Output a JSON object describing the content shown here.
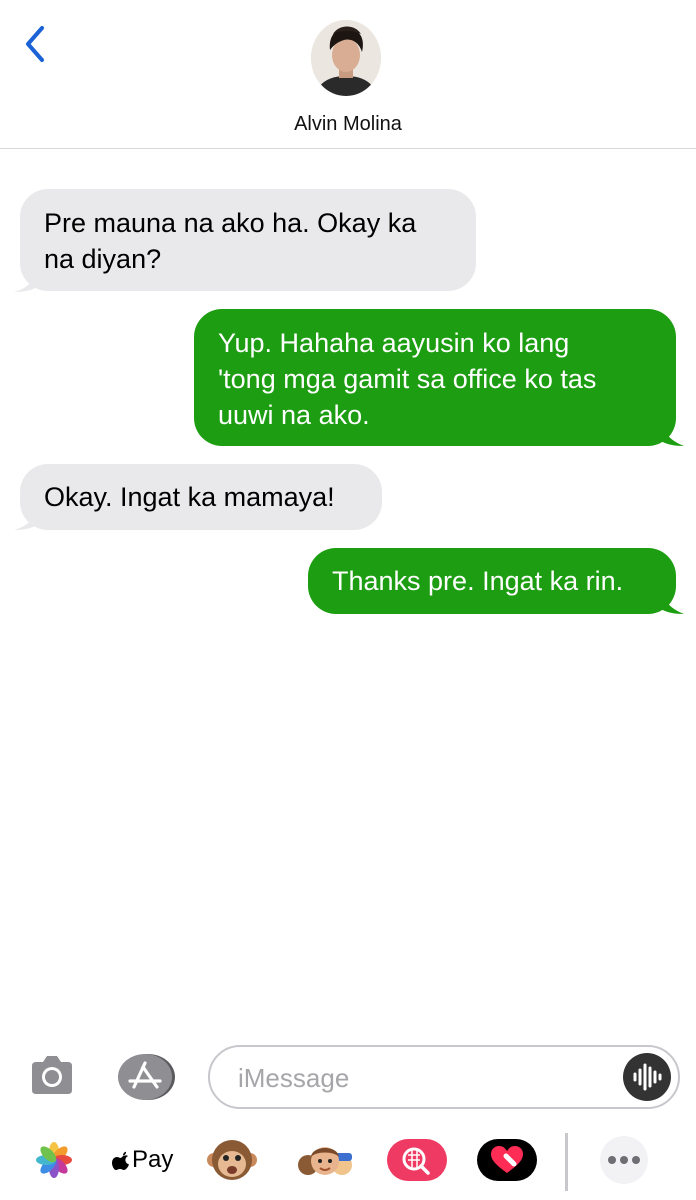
{
  "contact": {
    "name": "Alvin Molina"
  },
  "messages": [
    {
      "direction": "received",
      "lines": [
        "Pre mauna na ako ha. Okay ka",
        "na diyan?"
      ]
    },
    {
      "direction": "sent",
      "lines": [
        "Yup. Hahaha aayusin ko lang",
        "'tong mga gamit sa office ko tas",
        "uuwi na ako."
      ]
    },
    {
      "direction": "received",
      "lines": [
        "Okay. Ingat ka mamaya!"
      ]
    },
    {
      "direction": "sent",
      "lines": [
        "Thanks pre. Ingat ka rin."
      ]
    }
  ],
  "input": {
    "placeholder": "iMessage",
    "value": ""
  },
  "icons": {
    "back": "chevron-left-icon",
    "camera": "camera-icon",
    "apps": "app-store-icon",
    "audio": "audio-waveform-icon"
  },
  "app_strip": {
    "items": [
      "photos-icon",
      "apple-pay-icon",
      "animoji-icon",
      "memoji-icon",
      "search-images-icon",
      "digital-touch-icon",
      "more-icon"
    ],
    "apple_pay_label": "Pay"
  },
  "colors": {
    "accent": "#1a62d6",
    "sent_bubble": "#1d9e12",
    "received_bubble": "#e9e9eb"
  }
}
